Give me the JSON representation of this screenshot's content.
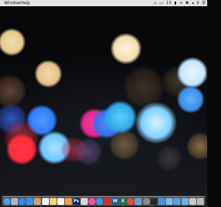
{
  "menubar": {
    "items": [
      "Window",
      "Help"
    ],
    "status": {
      "battery": "10",
      "icons": [
        "dropbox-icon",
        "display-icon",
        "battery-icon",
        "wifi-icon",
        "bluetooth-icon",
        "volume-icon",
        "search-icon",
        "notification-center-icon"
      ]
    }
  },
  "wallpaper": {
    "description_colors": {
      "warm": "#f3dcae",
      "blue": "#2f7cff",
      "cyan": "#9fe0ff",
      "red": "#ff2a3a",
      "magenta": "#ff2a9a"
    }
  },
  "dock": {
    "apps": [
      {
        "name": "finder",
        "icon": "finder-icon",
        "color": "#4aa3f0"
      },
      {
        "name": "launchpad",
        "icon": "rocket-icon",
        "color": "#b0b4bb"
      },
      {
        "name": "safari",
        "icon": "compass-icon",
        "color": "#1e90ff"
      },
      {
        "name": "mail",
        "icon": "mail-icon",
        "color": "#3b8fe8"
      },
      {
        "name": "contacts",
        "icon": "contacts-icon",
        "color": "#c8a070"
      },
      {
        "name": "calendar",
        "icon": "calendar-icon",
        "color": "#f2f2f2"
      },
      {
        "name": "notes",
        "icon": "notes-icon",
        "color": "#f5d76e"
      },
      {
        "name": "reminders",
        "icon": "reminders-icon",
        "color": "#f7f7f7"
      },
      {
        "name": "photos",
        "icon": "photos-icon",
        "color": "#f0a040"
      },
      {
        "name": "photoshop",
        "icon": "photoshop-icon",
        "color": "#0a2a55",
        "glyph": "Ps"
      },
      {
        "name": "stickies",
        "icon": "document-icon",
        "color": "#d8d8d8"
      },
      {
        "name": "itunes",
        "icon": "music-icon",
        "color": "#ff4aa0"
      },
      {
        "name": "app-store",
        "icon": "app-store-icon",
        "color": "#2a9cf0"
      },
      {
        "name": "pdf",
        "icon": "pdf-icon",
        "color": "#d62d20"
      },
      {
        "name": "word",
        "icon": "word-icon",
        "color": "#2b579a",
        "glyph": "W"
      },
      {
        "name": "excel",
        "icon": "excel-icon",
        "color": "#1e7145",
        "glyph": "X"
      },
      {
        "name": "chrome",
        "icon": "chrome-icon",
        "color": "#e8453c"
      },
      {
        "name": "preview",
        "icon": "preview-icon",
        "color": "#6aa0d8"
      },
      {
        "name": "settings",
        "icon": "gear-icon",
        "color": "#8a8a8f"
      },
      {
        "name": "terminal",
        "icon": "terminal-icon",
        "color": "#2a2a2a"
      },
      {
        "name": "keynote",
        "icon": "keynote-icon",
        "color": "#4a90e2"
      },
      {
        "name": "downloads",
        "icon": "folder-icon",
        "color": "#7ab8e8"
      },
      {
        "name": "downloads2",
        "icon": "downloads-folder-icon",
        "color": "#5aa2e0"
      },
      {
        "name": "documents",
        "icon": "documents-folder-icon",
        "color": "#6cb0e6"
      },
      {
        "name": "stack",
        "icon": "stack-icon",
        "color": "#c9c9c9"
      },
      {
        "name": "trash",
        "icon": "trash-icon",
        "color": "#b8bcc2"
      }
    ]
  }
}
